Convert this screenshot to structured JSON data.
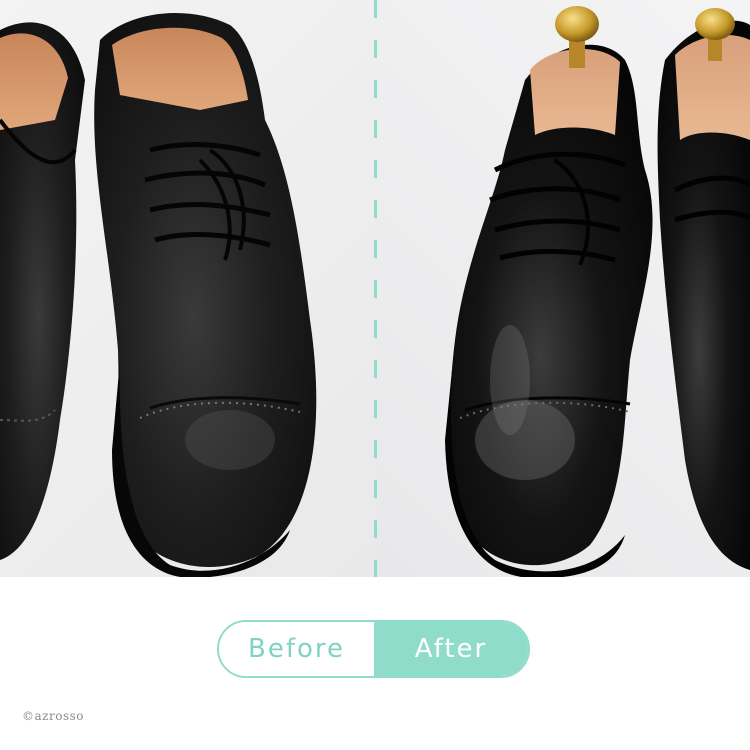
{
  "compare": {
    "before_label": "Before",
    "after_label": "After"
  },
  "footer": {
    "copyright": "©azrosso"
  },
  "colors": {
    "accent": "#8fdccb",
    "accent_text": "#7fd3c0",
    "background": "#ffffff"
  }
}
